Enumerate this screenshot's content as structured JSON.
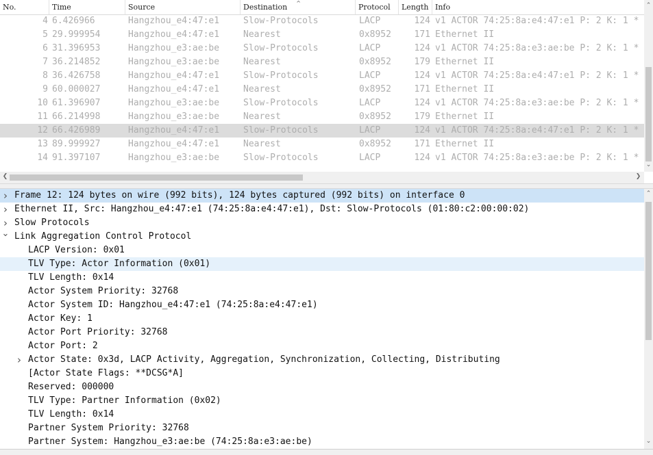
{
  "columns": [
    "No.",
    "Time",
    "Source",
    "Destination",
    "Protocol",
    "Length",
    "Info"
  ],
  "packets": [
    {
      "no": "4",
      "time": "6.426966",
      "source": "Hangzhou_e4:47:e1",
      "destination": "Slow-Protocols",
      "protocol": "LACP",
      "length": "124",
      "info": "v1 ACTOR 74:25:8a:e4:47:e1 P: 2 K: 1 *"
    },
    {
      "no": "5",
      "time": "29.999954",
      "source": "Hangzhou_e4:47:e1",
      "destination": "Nearest",
      "protocol": "0x8952",
      "length": "171",
      "info": "Ethernet II"
    },
    {
      "no": "6",
      "time": "31.396953",
      "source": "Hangzhou_e3:ae:be",
      "destination": "Slow-Protocols",
      "protocol": "LACP",
      "length": "124",
      "info": "v1 ACTOR 74:25:8a:e3:ae:be P: 2 K: 1 *"
    },
    {
      "no": "7",
      "time": "36.214852",
      "source": "Hangzhou_e3:ae:be",
      "destination": "Nearest",
      "protocol": "0x8952",
      "length": "179",
      "info": "Ethernet II"
    },
    {
      "no": "8",
      "time": "36.426758",
      "source": "Hangzhou_e4:47:e1",
      "destination": "Slow-Protocols",
      "protocol": "LACP",
      "length": "124",
      "info": "v1 ACTOR 74:25:8a:e4:47:e1 P: 2 K: 1 *"
    },
    {
      "no": "9",
      "time": "60.000027",
      "source": "Hangzhou_e4:47:e1",
      "destination": "Nearest",
      "protocol": "0x8952",
      "length": "171",
      "info": "Ethernet II"
    },
    {
      "no": "10",
      "time": "61.396907",
      "source": "Hangzhou_e3:ae:be",
      "destination": "Slow-Protocols",
      "protocol": "LACP",
      "length": "124",
      "info": "v1 ACTOR 74:25:8a:e3:ae:be P: 2 K: 1 *"
    },
    {
      "no": "11",
      "time": "66.214998",
      "source": "Hangzhou_e3:ae:be",
      "destination": "Nearest",
      "protocol": "0x8952",
      "length": "179",
      "info": "Ethernet II"
    },
    {
      "no": "12",
      "time": "66.426989",
      "source": "Hangzhou_e4:47:e1",
      "destination": "Slow-Protocols",
      "protocol": "LACP",
      "length": "124",
      "info": "v1 ACTOR 74:25:8a:e4:47:e1 P: 2 K: 1 *"
    },
    {
      "no": "13",
      "time": "89.999927",
      "source": "Hangzhou_e4:47:e1",
      "destination": "Nearest",
      "protocol": "0x8952",
      "length": "171",
      "info": "Ethernet II"
    },
    {
      "no": "14",
      "time": "91.397107",
      "source": "Hangzhou_e3:ae:be",
      "destination": "Slow-Protocols",
      "protocol": "LACP",
      "length": "124",
      "info": "v1 ACTOR 74:25:8a:e3:ae:be P: 2 K: 1 *"
    }
  ],
  "selected_packet": "12",
  "details": [
    {
      "text": "Frame 12: 124 bytes on wire (992 bits), 124 bytes captured (992 bits) on interface 0",
      "indent": 0,
      "twisty": "collapsed",
      "state": "selected"
    },
    {
      "text": "Ethernet II, Src: Hangzhou_e4:47:e1 (74:25:8a:e4:47:e1), Dst: Slow-Protocols (01:80:c2:00:00:02)",
      "indent": 0,
      "twisty": "collapsed",
      "state": ""
    },
    {
      "text": "Slow Protocols",
      "indent": 0,
      "twisty": "collapsed",
      "state": ""
    },
    {
      "text": "Link Aggregation Control Protocol",
      "indent": 0,
      "twisty": "expanded",
      "state": ""
    },
    {
      "text": "LACP Version: 0x01",
      "indent": 1,
      "twisty": "",
      "state": ""
    },
    {
      "text": "TLV Type: Actor Information (0x01)",
      "indent": 1,
      "twisty": "",
      "state": "hover"
    },
    {
      "text": "TLV Length: 0x14",
      "indent": 1,
      "twisty": "",
      "state": ""
    },
    {
      "text": "Actor System Priority: 32768",
      "indent": 1,
      "twisty": "",
      "state": ""
    },
    {
      "text": "Actor System ID: Hangzhou_e4:47:e1 (74:25:8a:e4:47:e1)",
      "indent": 1,
      "twisty": "",
      "state": ""
    },
    {
      "text": "Actor Key: 1",
      "indent": 1,
      "twisty": "",
      "state": ""
    },
    {
      "text": "Actor Port Priority: 32768",
      "indent": 1,
      "twisty": "",
      "state": ""
    },
    {
      "text": "Actor Port: 2",
      "indent": 1,
      "twisty": "",
      "state": ""
    },
    {
      "text": "Actor State: 0x3d, LACP Activity, Aggregation, Synchronization, Collecting, Distributing",
      "indent": 1,
      "twisty": "collapsed",
      "state": ""
    },
    {
      "text": "[Actor State Flags: **DCSG*A]",
      "indent": 1,
      "twisty": "",
      "state": ""
    },
    {
      "text": "Reserved: 000000",
      "indent": 1,
      "twisty": "",
      "state": ""
    },
    {
      "text": "TLV Type: Partner Information (0x02)",
      "indent": 1,
      "twisty": "",
      "state": ""
    },
    {
      "text": "TLV Length: 0x14",
      "indent": 1,
      "twisty": "",
      "state": ""
    },
    {
      "text": "Partner System Priority: 32768",
      "indent": 1,
      "twisty": "",
      "state": ""
    },
    {
      "text": "Partner System: Hangzhou_e3:ae:be (74:25:8a:e3:ae:be)",
      "indent": 1,
      "twisty": "",
      "state": ""
    }
  ],
  "icons": {
    "sort": "sort-ascending-icon",
    "collapsed": "chevron-right-icon",
    "expanded": "chevron-down-icon"
  },
  "colors": {
    "selected_detail": "#cde3f7",
    "hover_detail": "#e5f1fb",
    "selected_row": "#dcdcdc",
    "ignored_text": "#aeaeae"
  }
}
